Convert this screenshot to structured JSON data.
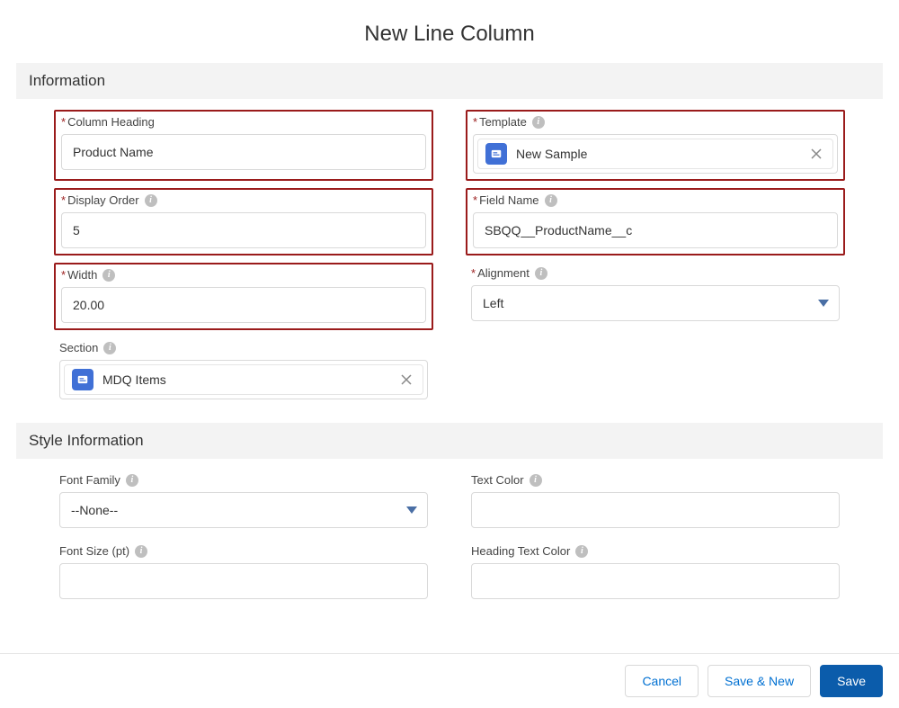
{
  "pageTitle": "New Line Column",
  "sections": {
    "info": "Information",
    "style": "Style Information"
  },
  "fields": {
    "columnHeading": {
      "label": "Column Heading",
      "value": "Product Name"
    },
    "template": {
      "label": "Template",
      "value": "New Sample"
    },
    "displayOrder": {
      "label": "Display Order",
      "value": "5"
    },
    "fieldName": {
      "label": "Field Name",
      "value": "SBQQ__ProductName__c"
    },
    "width": {
      "label": "Width",
      "value": "20.00"
    },
    "alignment": {
      "label": "Alignment",
      "value": "Left"
    },
    "section": {
      "label": "Section",
      "value": "MDQ Items"
    },
    "fontFamily": {
      "label": "Font Family",
      "value": "--None--"
    },
    "textColor": {
      "label": "Text Color",
      "value": ""
    },
    "fontSize": {
      "label": "Font Size (pt)",
      "value": ""
    },
    "headingTextColor": {
      "label": "Heading Text Color",
      "value": ""
    }
  },
  "buttons": {
    "cancel": "Cancel",
    "saveNew": "Save & New",
    "save": "Save"
  }
}
